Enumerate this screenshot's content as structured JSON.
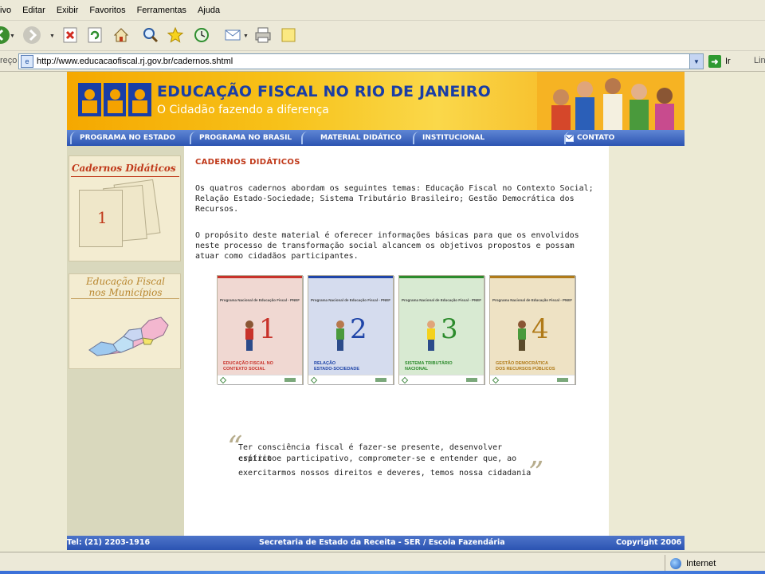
{
  "browser": {
    "menu": [
      "ivo",
      "Editar",
      "Exibir",
      "Favoritos",
      "Ferramentas",
      "Ajuda"
    ],
    "toolbar_icons": [
      "back-icon",
      "forward-icon",
      "stop-icon",
      "refresh-icon",
      "home-icon",
      "search-icon",
      "favorites-icon",
      "history-icon",
      "mail-icon",
      "print-icon",
      "edit-icon"
    ],
    "address_label": "reço",
    "url": "http://www.educacaofiscal.rj.gov.br/cadernos.shtml",
    "go_label": "Ir",
    "links_label": "Lin",
    "status_zone": "Internet"
  },
  "site": {
    "title": "EDUCAÇÃO FISCAL NO RIO DE JANEIRO",
    "subtitle": "O Cidadão fazendo a diferença",
    "nav": [
      "PROGRAMA NO ESTADO",
      "PROGRAMA NO BRASIL",
      "MATERIAL DIDÁTICO",
      "INSTITUCIONAL",
      "CONTATO"
    ],
    "sidebar": {
      "box1_title": "Cadernos Didáticos",
      "box1_book_number": "1",
      "box2_title_line1": "Educação Fiscal",
      "box2_title_line2": "nos Municípios"
    },
    "main": {
      "section_title": "CADERNOS DIDÁTICOS",
      "para1_lines": [
        "Os quatros cadernos abordam os seguintes temas: Educação Fiscal no Contexto Social;",
        "Relação Estado-Sociedade; Sistema Tributário Brasileiro; Gestão Democrática dos",
        "Recursos."
      ],
      "para2_lines": [
        "O propósito deste material é oferecer informações básicas para que os envolvidos",
        "neste processo de transformação social alcancem os objetivos propostos e possam",
        "atuar como cidadãos participantes."
      ],
      "covers": [
        {
          "header": "Programa Nacional de Educação Fiscal - PNEF",
          "number": "1",
          "title_line1": "EDUCAÇÃO FISCAL NO",
          "title_line2": "CONTEXTO SOCIAL",
          "color": "#c8322a",
          "bg": "#f0d8d2"
        },
        {
          "header": "Programa Nacional de Educação Fiscal - PNEF",
          "number": "2",
          "title_line1": "RELAÇÃO",
          "title_line2": "ESTADO-SOCIEDADE",
          "color": "#1f45a8",
          "bg": "#d5dcee"
        },
        {
          "header": "Programa Nacional de Educação Fiscal - PNEF",
          "number": "3",
          "title_line1": "SISTEMA TRIBUTÁRIO",
          "title_line2": "NACIONAL",
          "color": "#2c8b2c",
          "bg": "#d8ead2"
        },
        {
          "header": "Programa Nacional de Educação Fiscal - PNEF",
          "number": "4",
          "title_line1": "GESTÃO DEMOCRÁTICA",
          "title_line2": "DOS RECURSOS PÚBLICOS",
          "color": "#b07a18",
          "bg": "#eee2c4"
        }
      ],
      "quote_lines": [
        "Ter consciência fiscal é fazer-se presente, desenvolver espírito",
        "crítico e participativo, comprometer-se e entender que, ao",
        "exercitarmos nossos direitos e deveres, temos nossa cidadania"
      ]
    },
    "footer": {
      "phone": "Tel: (21) 2203-1916",
      "secretaria": "Secretaria de Estado da Receita - SER / Escola Fazendária",
      "copyright": "Copyright 2006"
    }
  },
  "colors": {
    "nav_blue": "#2c54b2",
    "title_blue": "#1a3ea6",
    "section_red": "#c0391a",
    "banner_orange": "#f5a800"
  }
}
